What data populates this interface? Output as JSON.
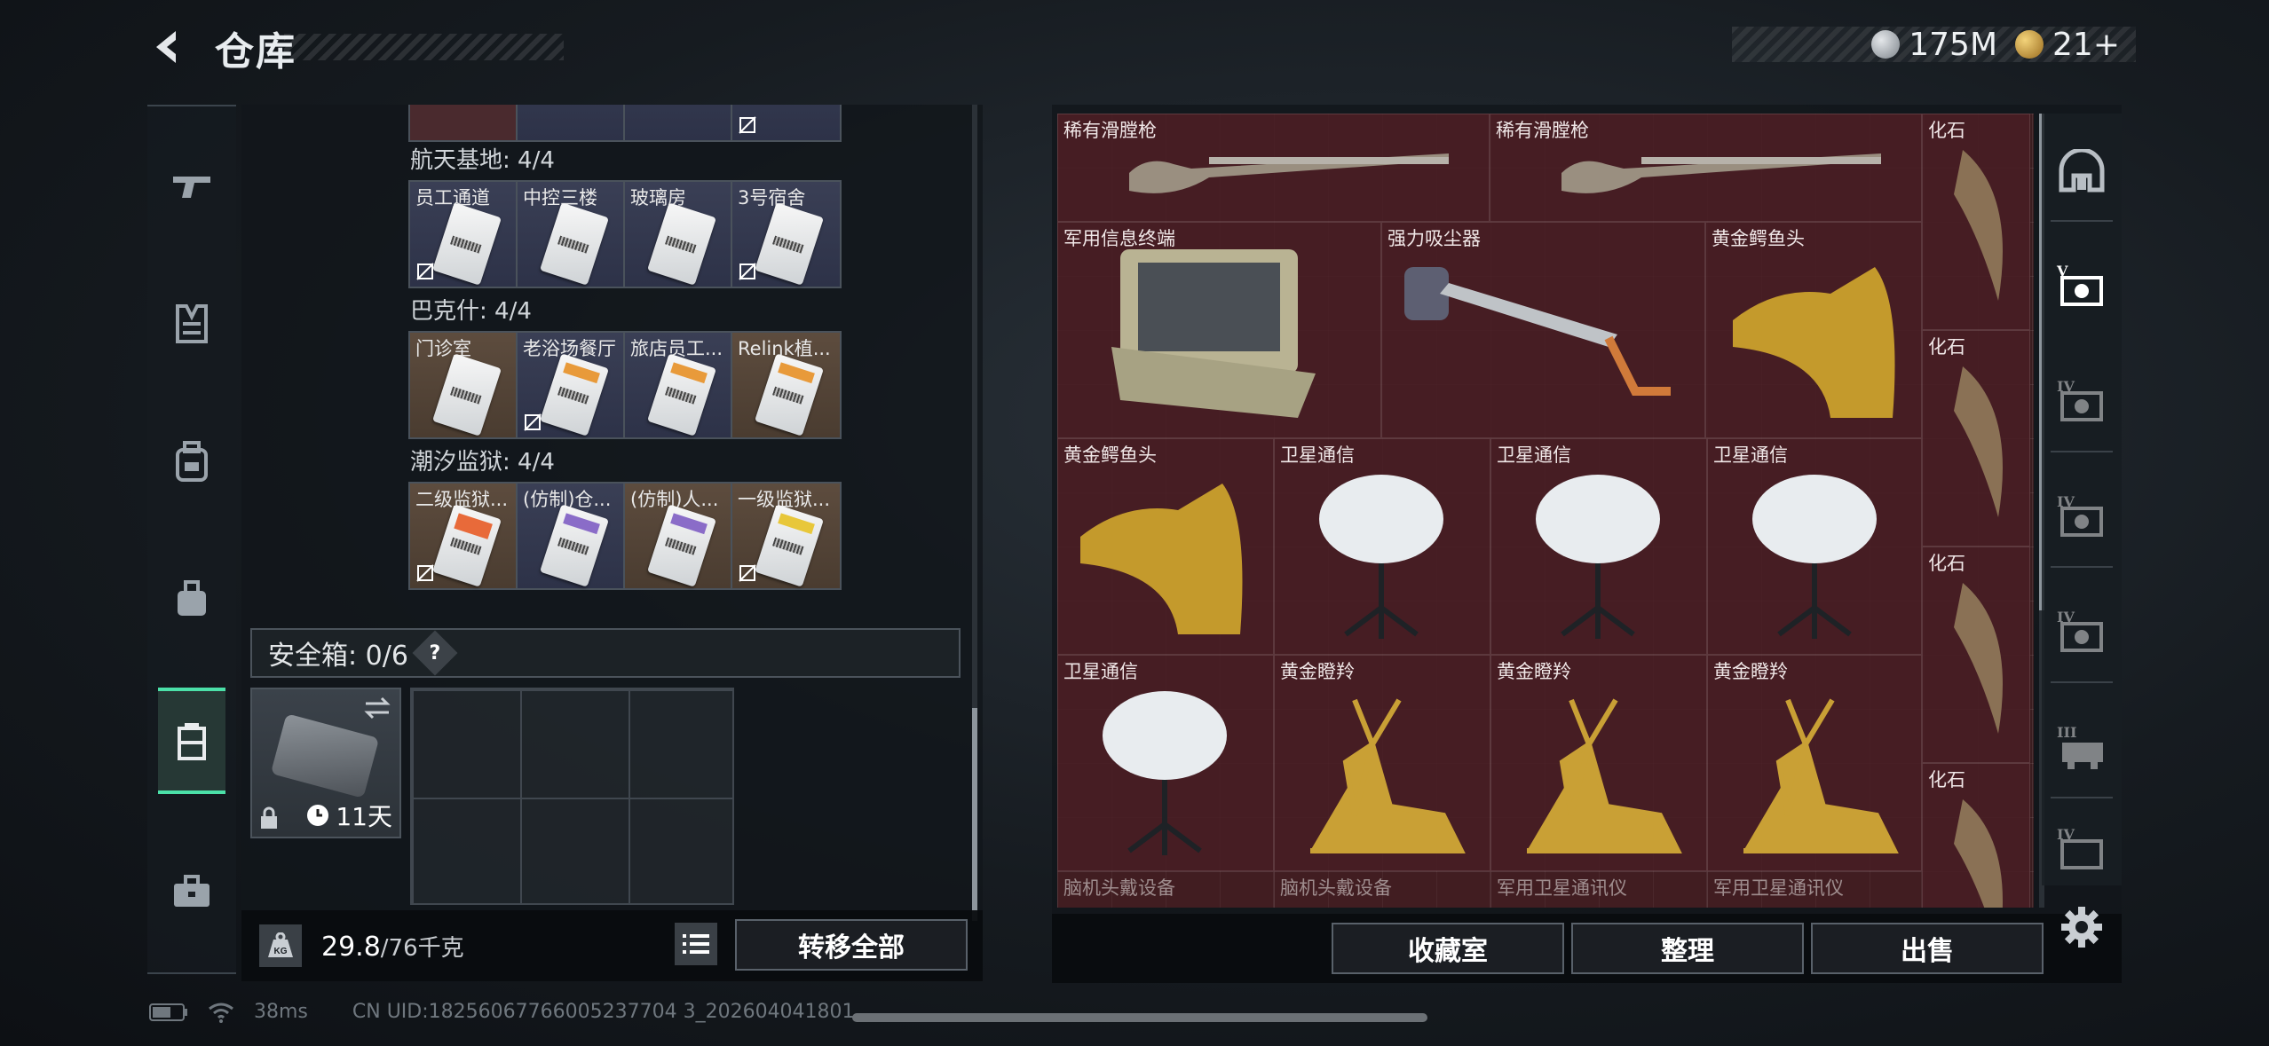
{
  "header": {
    "title": "仓库",
    "currencies": [
      {
        "icon": "silver-coin-icon",
        "value": "175M",
        "color": "#b9bec4"
      },
      {
        "icon": "gold-triangle-coin-icon",
        "value": "21+",
        "color": "#d7a54a"
      }
    ]
  },
  "left_nav": [
    "gun-icon",
    "vest-icon",
    "backpack-icon",
    "bag-icon",
    "safe-case-icon",
    "briefcase-icon"
  ],
  "key_sections": [
    {
      "title": "航天基地: 4/4",
      "theme": "blue",
      "keys": [
        {
          "label": "员工通道",
          "unbound": true
        },
        {
          "label": "中控三楼",
          "unbound": false
        },
        {
          "label": "玻璃房",
          "unbound": false
        },
        {
          "label": "3号宿舍",
          "unbound": true
        }
      ]
    },
    {
      "title": "巴克什: 4/4",
      "theme": "gold",
      "keys": [
        {
          "label": "门诊室",
          "unbound": false
        },
        {
          "label": "老浴场餐厅",
          "unbound": true
        },
        {
          "label": "旅店员工...",
          "unbound": false
        },
        {
          "label": "Relink植...",
          "unbound": false
        }
      ]
    },
    {
      "title": "潮汐监狱: 4/4",
      "theme": "gold",
      "keys": [
        {
          "label": "二级监狱...",
          "unbound": true
        },
        {
          "label": "(仿制)仓...",
          "unbound": false
        },
        {
          "label": "(仿制)人...",
          "unbound": false
        },
        {
          "label": "一级监狱...",
          "unbound": true
        }
      ]
    }
  ],
  "safe": {
    "label": "安全箱: 0/6",
    "help": "?",
    "days": "11天"
  },
  "footer_left": {
    "weight_current": "29.8",
    "weight_max": "/76千克",
    "transfer_label": "转移全部"
  },
  "items": [
    {
      "label": "稀有滑膛枪"
    },
    {
      "label": "稀有滑膛枪"
    },
    {
      "label": "化石"
    },
    {
      "label": "军用信息终端"
    },
    {
      "label": "强力吸尘器"
    },
    {
      "label": "黄金鳄鱼头"
    },
    {
      "label": "化石"
    },
    {
      "label": "黄金鳄鱼头"
    },
    {
      "label": "卫星通信"
    },
    {
      "label": "卫星通信"
    },
    {
      "label": "卫星通信"
    },
    {
      "label": "化石"
    },
    {
      "label": "卫星通信"
    },
    {
      "label": "黄金瞪羚"
    },
    {
      "label": "黄金瞪羚"
    },
    {
      "label": "黄金瞪羚"
    },
    {
      "label": "化石"
    },
    {
      "label": "脑机头戴设备"
    },
    {
      "label": "脑机头戴设备"
    },
    {
      "label": "军用卫星通讯仪"
    },
    {
      "label": "军用卫星通讯仪"
    }
  ],
  "right_buttons": {
    "collection": "收藏室",
    "sort": "整理",
    "sell": "出售"
  },
  "category_rail": [
    {
      "icon": "all-items-icon",
      "tier": ""
    },
    {
      "icon": "tier-v-gear-icon",
      "tier": "V"
    },
    {
      "icon": "tier-iv-gear-icon",
      "tier": "IV"
    },
    {
      "icon": "tier-iv-gear-icon",
      "tier": "IV"
    },
    {
      "icon": "tier-iv-gear-icon",
      "tier": "IV"
    },
    {
      "icon": "tier-iii-gear-icon",
      "tier": "III"
    },
    {
      "icon": "tier-iv-gear-icon",
      "tier": "IV"
    }
  ],
  "status_bar": {
    "ping": "38ms",
    "uid": "CN UID:18256067766005237704 3_202604041801"
  }
}
